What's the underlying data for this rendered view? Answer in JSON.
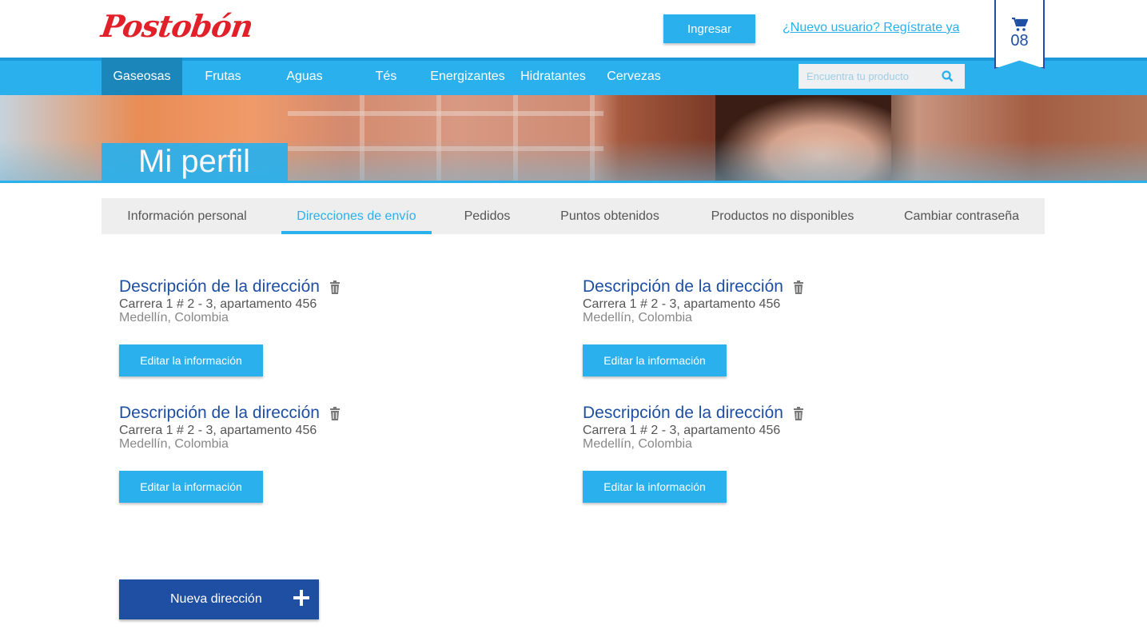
{
  "header": {
    "logo": "Postobón",
    "login_label": "Ingresar",
    "register_label": "¿Nuevo usuario? Regístrate ya",
    "cart_count": "08"
  },
  "nav": {
    "items": [
      {
        "label": "Gaseosas",
        "active": true
      },
      {
        "label": "Frutas"
      },
      {
        "label": "Aguas"
      },
      {
        "label": "Tés"
      },
      {
        "label": "Energizantes"
      },
      {
        "label": "Hidratantes"
      },
      {
        "label": "Cervezas"
      }
    ],
    "search_placeholder": "Encuentra tu producto"
  },
  "banner": {
    "title": "Mi perfil"
  },
  "tabs": [
    {
      "label": "Información personal"
    },
    {
      "label": "Direcciones de envío",
      "active": true
    },
    {
      "label": "Pedidos"
    },
    {
      "label": "Puntos obtenidos"
    },
    {
      "label": "Productos no disponibles"
    },
    {
      "label": "Cambiar contraseña"
    }
  ],
  "addresses": [
    {
      "title": "Descripción de la dirección",
      "line1": "Carrera 1 # 2 - 3, apartamento 456",
      "line2": "Medellín, Colombia",
      "edit_label": "Editar la información"
    },
    {
      "title": "Descripción de la dirección",
      "line1": "Carrera 1 # 2 - 3, apartamento 456",
      "line2": "Medellín, Colombia",
      "edit_label": "Editar la información"
    },
    {
      "title": "Descripción de la dirección",
      "line1": "Carrera 1 # 2 - 3, apartamento 456",
      "line2": "Medellín, Colombia",
      "edit_label": "Editar la información"
    },
    {
      "title": "Descripción de la dirección",
      "line1": "Carrera 1 # 2 - 3, apartamento 456",
      "line2": "Medellín, Colombia",
      "edit_label": "Editar la información"
    }
  ],
  "new_address_label": "Nueva dirección",
  "icons": {
    "cart": "shopping-cart-icon",
    "search": "search-icon",
    "trash": "trash-icon",
    "plus": "plus-icon"
  },
  "colors": {
    "primary": "#2ab0ec",
    "dark_blue": "#1e4fa3",
    "nav_active": "#1b86ba",
    "brand_red": "#e2202a"
  }
}
